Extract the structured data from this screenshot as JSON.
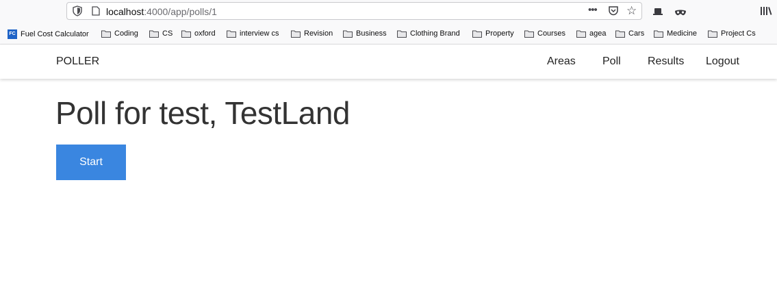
{
  "browser": {
    "url_host": "localhost",
    "url_path": ":4000/app/polls/1",
    "bookmarks": [
      {
        "label": "Fuel Cost Calculator",
        "icon": "fc-favicon"
      },
      {
        "label": "Coding",
        "icon": "folder-icon"
      },
      {
        "label": "CS",
        "icon": "folder-icon"
      },
      {
        "label": "oxford",
        "icon": "folder-icon"
      },
      {
        "label": "interview cs",
        "icon": "folder-icon"
      },
      {
        "label": "Revision",
        "icon": "folder-icon"
      },
      {
        "label": "Business",
        "icon": "folder-icon"
      },
      {
        "label": "Clothing Brand",
        "icon": "folder-icon"
      },
      {
        "label": "Property",
        "icon": "folder-icon"
      },
      {
        "label": "Courses",
        "icon": "folder-icon"
      },
      {
        "label": "agea",
        "icon": "folder-icon"
      },
      {
        "label": "Cars",
        "icon": "folder-icon"
      },
      {
        "label": "Medicine",
        "icon": "folder-icon"
      },
      {
        "label": "Project Cs",
        "icon": "folder-icon"
      }
    ]
  },
  "navbar": {
    "brand": "POLLER",
    "links": [
      "Areas",
      "Poll",
      "Results",
      "Logout"
    ]
  },
  "main": {
    "title": "Poll for test, TestLand",
    "start_label": "Start"
  },
  "colors": {
    "primary_button": "#3a86e0",
    "text": "#333333"
  }
}
